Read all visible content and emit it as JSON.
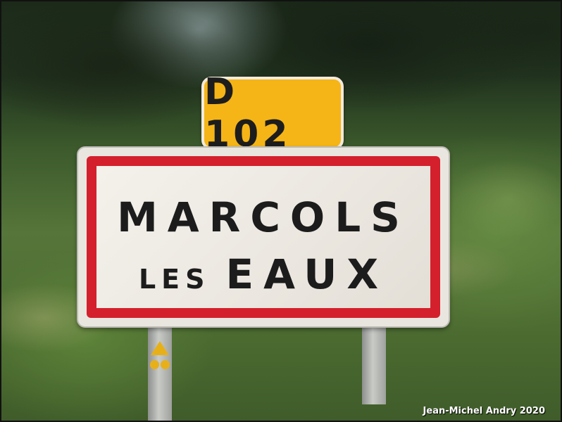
{
  "route_sign": {
    "label": "D 102",
    "background": "#f5b517"
  },
  "town_sign": {
    "line1": "MARCOLS",
    "line2_small": "LES",
    "line2_big": "EAUX",
    "border_color": "#d4202c"
  },
  "marker": {
    "color": "#e8b018"
  },
  "credit": "Jean-Michel Andry 2020"
}
